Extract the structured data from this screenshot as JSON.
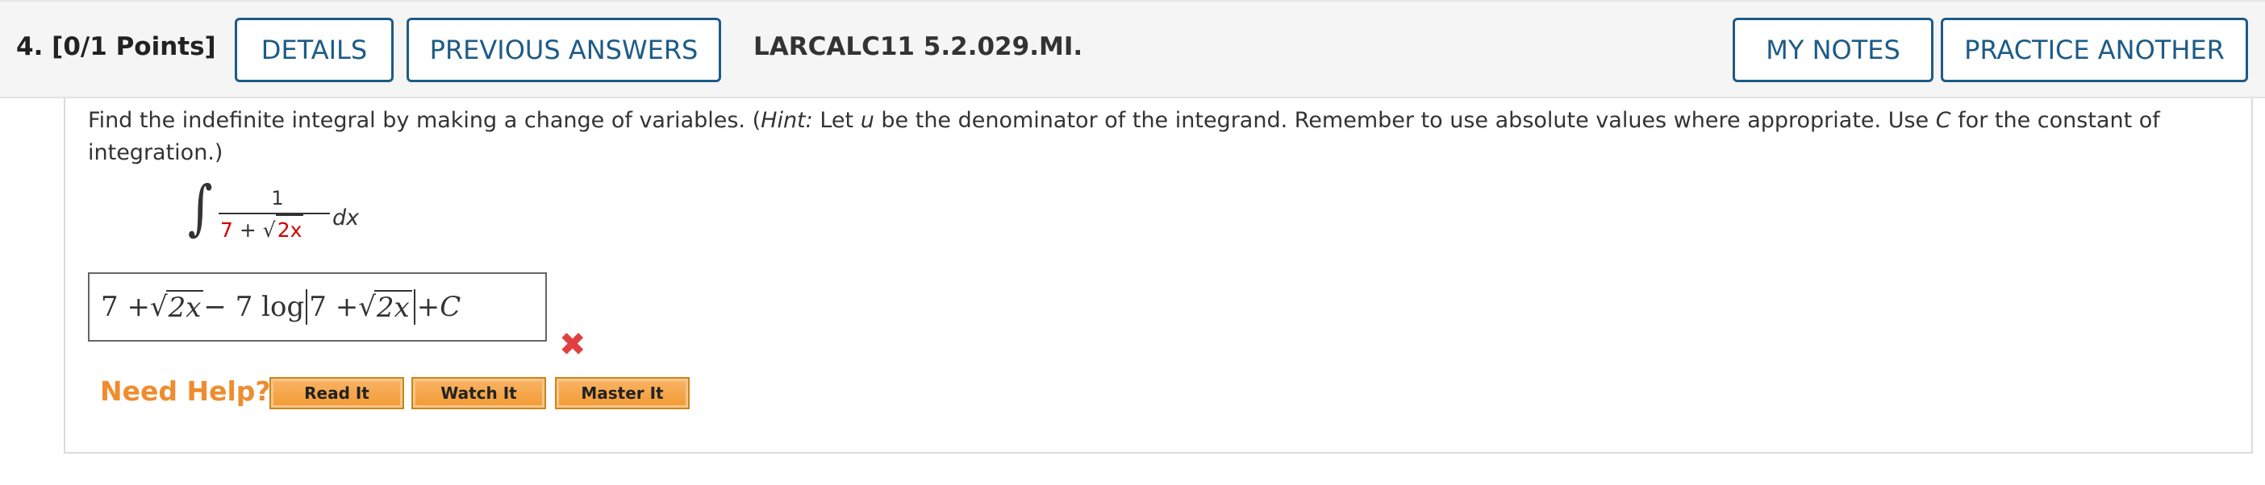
{
  "header": {
    "question_number": "4.",
    "points": "[0/1 Points]",
    "details_label": "DETAILS",
    "previous_answers_label": "PREVIOUS ANSWERS",
    "question_id": "LARCALC11 5.2.029.MI.",
    "my_notes_label": "MY NOTES",
    "practice_another_label": "PRACTICE ANOTHER"
  },
  "question": {
    "text_before_hint": "Find the indefinite integral by making a change of variables. (",
    "hint_label": "Hint:",
    "hint_text_1": " Let ",
    "var_u": "u",
    "hint_text_2": " be the denominator of the integrand. Remember to use absolute values where appropriate. Use ",
    "var_c": "C",
    "hint_text_3": " for the constant of integration.)",
    "integral": {
      "numerator": "1",
      "den_const": "7",
      "den_plus": " + ",
      "den_sqrt_symbol": "√",
      "den_radicand": "2x",
      "differential": "dx"
    }
  },
  "answer": {
    "part1": "7 + ",
    "sqrt_symbol": "√",
    "radicand1": "2x",
    "part2": " − 7 log",
    "part3": "7 + ",
    "radicand2": "2x",
    "part4": " + ",
    "const": "C",
    "status_icon": "x-mark-icon",
    "status": "incorrect"
  },
  "help": {
    "label": "Need Help?",
    "read_it": "Read It",
    "watch_it": "Watch It",
    "master_it": "Master It"
  },
  "colors": {
    "accent": "#1d5b86",
    "help_orange": "#ef8c2e",
    "error_red": "#e04040",
    "highlight_red": "#d40000"
  }
}
